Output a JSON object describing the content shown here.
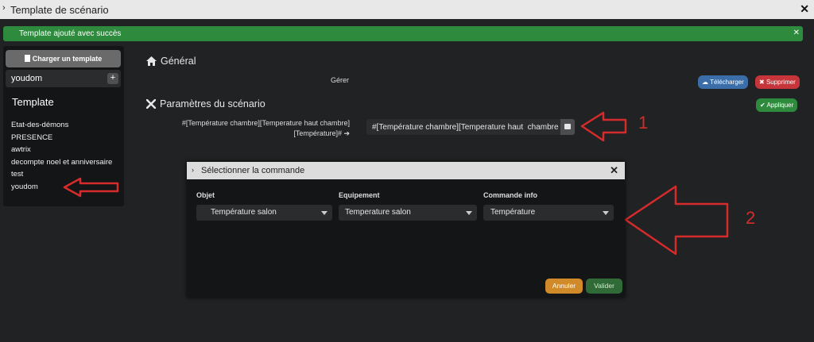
{
  "window": {
    "title": "Template de scénario"
  },
  "alert": {
    "message": "Template ajouté avec succès"
  },
  "sidebar": {
    "load_button": "Charger un template",
    "search_value": "youdom",
    "heading": "Template",
    "templates": [
      "Etat-des-démons",
      "PRESENCE",
      "awtrix",
      "decompte noel et anniversaire",
      "test",
      "youdom"
    ]
  },
  "general": {
    "title": "Général",
    "manage_label": "Gérer"
  },
  "actions": {
    "download": "Télécharger",
    "delete": "Supprimer",
    "apply": "Appliquer"
  },
  "params": {
    "title": "Paramètres du scénario",
    "row_label_1": "#[Température chambre][Temperature haut chambre]",
    "row_label_2": "[Température]# ➔",
    "command_value": "#[Température chambre][Temperature haut  chambre"
  },
  "annotations": {
    "first": "1",
    "second": "2"
  },
  "modal": {
    "title": "Sélectionner la commande",
    "col_object": "Objet",
    "col_equipment": "Equipement",
    "col_command": "Commande info",
    "object_value": "Température salon",
    "equipment_value": "Temperature salon",
    "command_value": "Température",
    "cancel": "Annuler",
    "validate": "Valider"
  },
  "colors": {
    "background": "#212224",
    "success": "#2e8b3e",
    "danger": "#c6353a",
    "info": "#3b6ea8",
    "warning": "#d08a2a",
    "annotation": "#d62b2b"
  }
}
